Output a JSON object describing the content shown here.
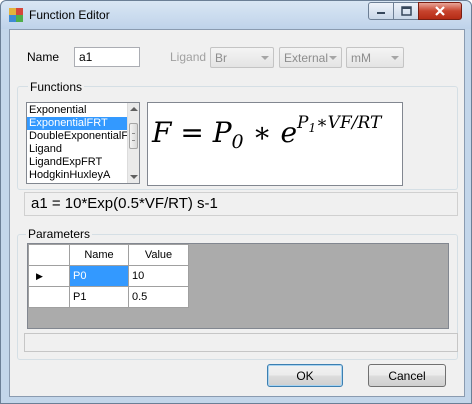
{
  "window": {
    "title": "Function Editor",
    "controls": {
      "minimize": "—",
      "maximize": "□",
      "close": "✕"
    }
  },
  "name_field": {
    "label": "Name",
    "value": "a1"
  },
  "ligand": {
    "label": "Ligand",
    "ligand_value": "Br",
    "location_value": "External",
    "unit_value": "mM"
  },
  "functions": {
    "group_label": "Functions",
    "items": [
      "Exponential",
      "ExponentialFRT",
      "DoubleExponentialF",
      "Ligand",
      "LigandExpFRT",
      "HodgkinHuxleyA"
    ],
    "selected_index": 1,
    "formula": {
      "lhs": "F = P",
      "sub": "0",
      "mid": " ∗ e",
      "sup_p": "P",
      "sup_sub": "1",
      "sup_rest": "∗VF/RT"
    }
  },
  "expression": "a1 = 10*Exp(0.5*VF/RT) s-1",
  "parameters": {
    "group_label": "Parameters",
    "columns": [
      "Name",
      "Value"
    ],
    "current_row_marker": "▶",
    "rows": [
      {
        "name": "P0",
        "value": "10"
      },
      {
        "name": "P1",
        "value": "0.5"
      }
    ]
  },
  "buttons": {
    "ok": "OK",
    "cancel": "Cancel"
  },
  "colors": {
    "selection": "#3399ff",
    "grid_background": "#ababab",
    "close_button": "#c7432d"
  }
}
